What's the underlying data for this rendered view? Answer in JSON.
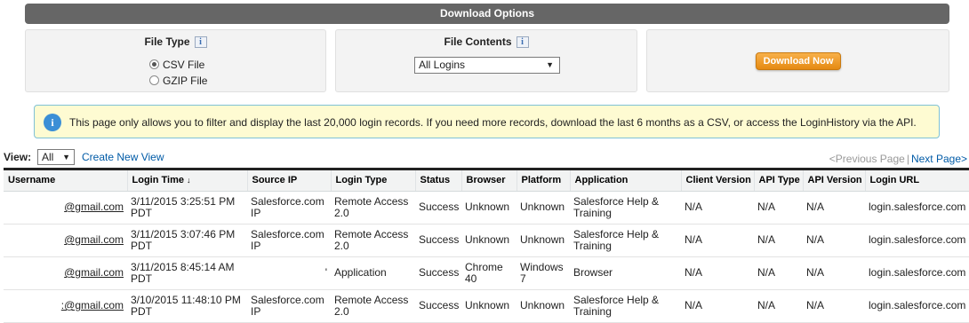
{
  "header": {
    "title": "Download Options"
  },
  "file_type": {
    "title": "File Type",
    "info_label": "i",
    "options": [
      {
        "label": "CSV File",
        "selected": true
      },
      {
        "label": "GZIP File",
        "selected": false
      }
    ]
  },
  "file_contents": {
    "title": "File Contents",
    "info_label": "i",
    "selected": "All Logins"
  },
  "download": {
    "button_label": "Download Now"
  },
  "alert": {
    "icon": "i",
    "text": "This page only allows you to filter and display the last 20,000 login records. If you need more records, download the last 6 months as a CSV, or access the LoginHistory via the API."
  },
  "view": {
    "label": "View:",
    "selected": "All",
    "create_link": "Create New View"
  },
  "pager": {
    "prev": "<Previous Page",
    "separator": "|",
    "next": "Next Page>"
  },
  "table": {
    "columns": [
      "Username",
      "Login Time",
      "Source IP",
      "Login Type",
      "Status",
      "Browser",
      "Platform",
      "Application",
      "Client Version",
      "API Type",
      "API Version",
      "Login URL"
    ],
    "rows": [
      [
        "@gmail.com",
        "3/11/2015 3:25:51 PM PDT",
        "Salesforce.com IP",
        "Remote Access 2.0",
        "Success",
        "Unknown",
        "Unknown",
        "Salesforce Help & Training",
        "N/A",
        "N/A",
        "N/A",
        "login.salesforce.com"
      ],
      [
        "@gmail.com",
        "3/11/2015 3:07:46 PM PDT",
        "Salesforce.com IP",
        "Remote Access 2.0",
        "Success",
        "Unknown",
        "Unknown",
        "Salesforce Help & Training",
        "N/A",
        "N/A",
        "N/A",
        "login.salesforce.com"
      ],
      [
        "@gmail.com",
        "3/11/2015 8:45:14 AM PDT",
        "'",
        "Application",
        "Success",
        "Chrome 40",
        "Windows 7",
        "Browser",
        "N/A",
        "N/A",
        "N/A",
        "login.salesforce.com"
      ],
      [
        ":@gmail.com",
        "3/10/2015 11:48:10 PM PDT",
        "Salesforce.com IP",
        "Remote Access 2.0",
        "Success",
        "Unknown",
        "Unknown",
        "Salesforce Help & Training",
        "N/A",
        "N/A",
        "N/A",
        "login.salesforce.com"
      ]
    ]
  }
}
